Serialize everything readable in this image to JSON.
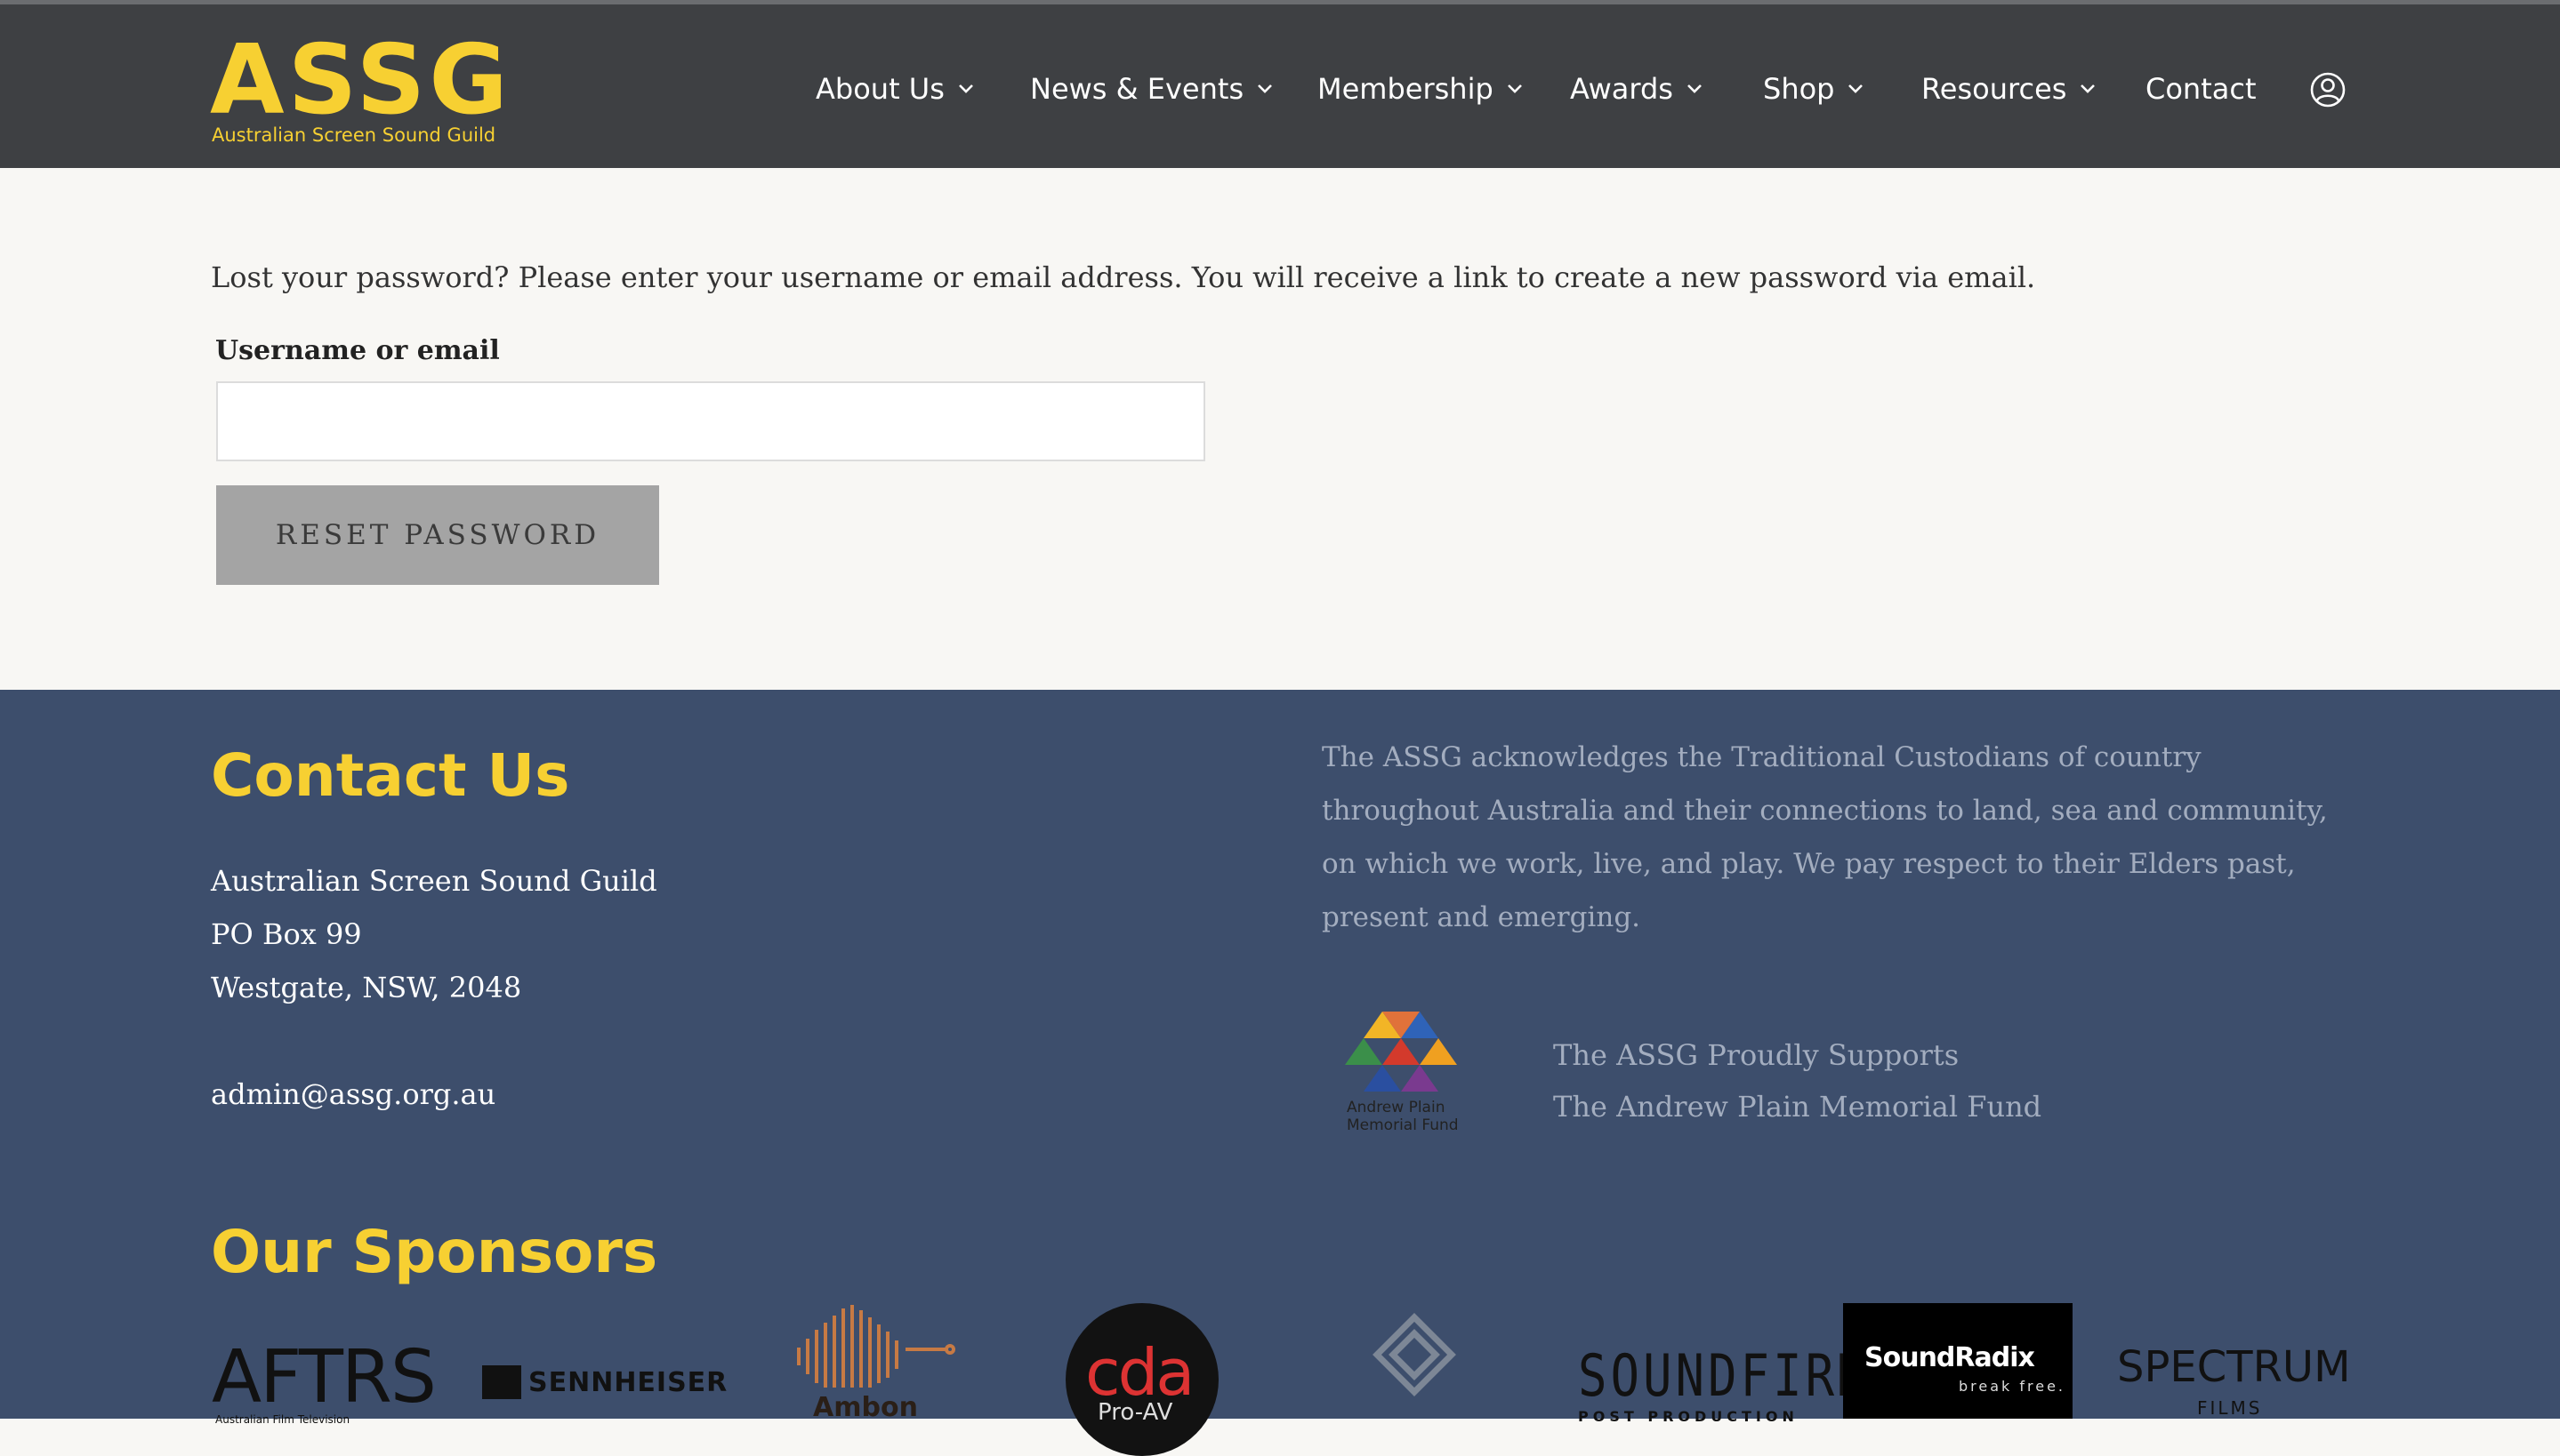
{
  "header": {
    "logo_text": "ASSG",
    "logo_subtitle": "Australian Screen Sound Guild",
    "nav": [
      {
        "label": "About Us",
        "has_dropdown": true
      },
      {
        "label": "News & Events",
        "has_dropdown": true
      },
      {
        "label": "Membership",
        "has_dropdown": true
      },
      {
        "label": "Awards",
        "has_dropdown": true
      },
      {
        "label": "Shop",
        "has_dropdown": true
      },
      {
        "label": "Resources",
        "has_dropdown": true
      },
      {
        "label": "Contact",
        "has_dropdown": false
      }
    ],
    "account_icon": "user-circle-icon"
  },
  "main": {
    "intro": "Lost your password? Please enter your username or email address. You will receive a link to create a new password via email.",
    "field_label": "Username or email",
    "field_value": "",
    "button_label": "RESET PASSWORD"
  },
  "footer": {
    "contact_title": "Contact Us",
    "address": [
      "Australian Screen Sound Guild",
      "PO Box 99",
      "Westgate, NSW, 2048"
    ],
    "email": "admin@assg.org.au",
    "acknowledgement": "The ASSG acknowledges the Traditional Custodians of country throughout Australia and their connections to land, sea and community, on which we work, live, and play. We pay respect to their Elders past, present and emerging.",
    "fund_logo_text": [
      "Andrew Plain",
      "Memorial Fund"
    ],
    "fund_lines": [
      "The ASSG Proudly Supports",
      "The Andrew Plain Memorial Fund"
    ],
    "sponsors_title": "Our Sponsors",
    "sponsors": {
      "aftrs": {
        "name": "AFTRS",
        "sub": "Australian Film Television"
      },
      "sennheiser": {
        "name": "SENNHEISER"
      },
      "ambon": {
        "name": "Ambon"
      },
      "cda": {
        "name": "cda",
        "sub": "Pro-AV"
      },
      "soundfirm": {
        "name": "SOUNDFIRM",
        "sub": "POST PRODUCTION"
      },
      "soundradix": {
        "name": "SoundRadix",
        "sub": "break free."
      },
      "spectrum": {
        "name": "SPECTRUM",
        "sub": "FILMS"
      }
    }
  },
  "colors": {
    "header_bg": "#3e4043",
    "accent_yellow": "#f7d032",
    "page_bg": "#f8f7f4",
    "footer_bg": "#3d4e6c",
    "button_bg": "#a4a4a4",
    "muted_text": "#a3adbf"
  }
}
